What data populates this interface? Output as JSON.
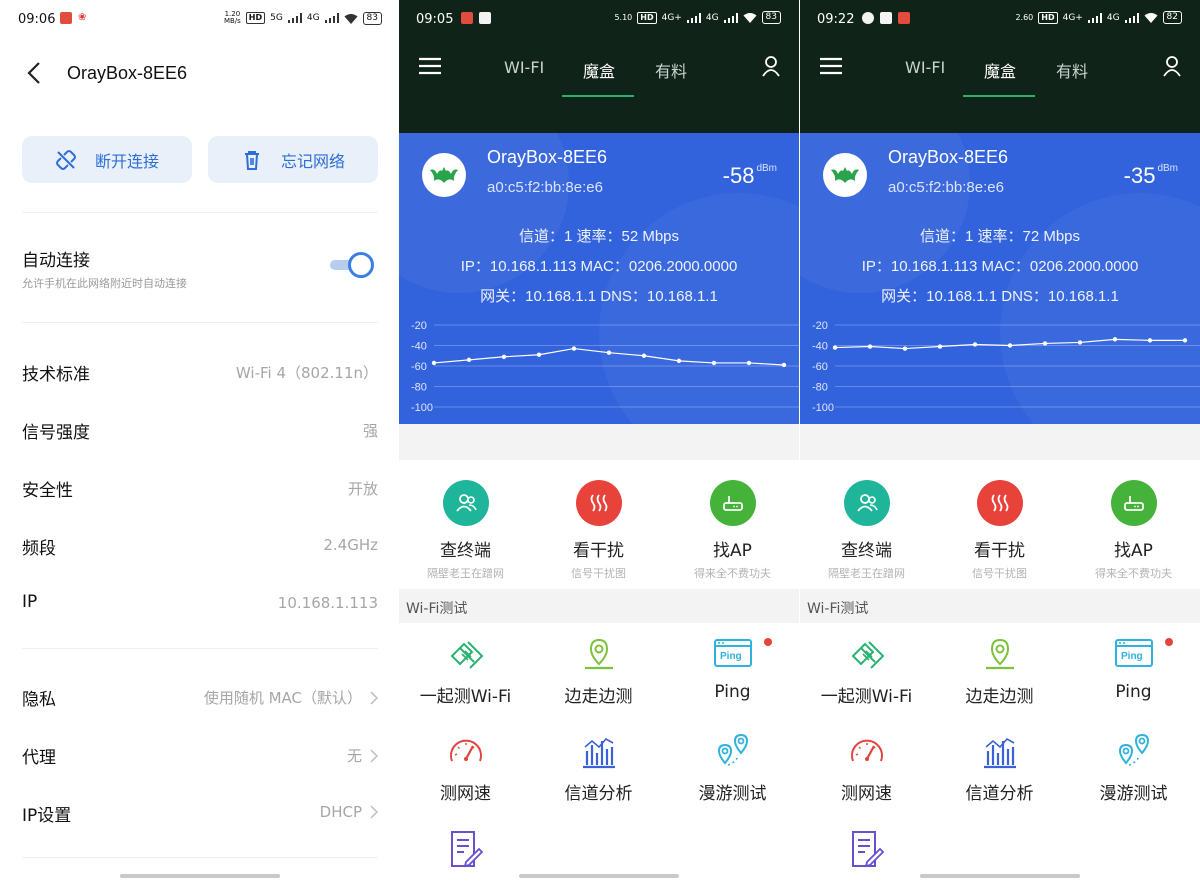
{
  "left": {
    "status": {
      "time": "09:06",
      "speed": "1.20\nMB/s",
      "net1": "5G",
      "net2": "4G",
      "battery": "83"
    },
    "title": "OrayBox-8EE6",
    "disconnect_label": "断开连接",
    "forget_label": "忘记网络",
    "auto_connect": {
      "label": "自动连接",
      "sub": "允许手机在此网络附近时自动连接",
      "on": true
    },
    "rows": [
      {
        "key": "技术标准",
        "value": "Wi-Fi 4（802.11n）",
        "chevron": false
      },
      {
        "key": "信号强度",
        "value": "强",
        "chevron": false
      },
      {
        "key": "安全性",
        "value": "开放",
        "chevron": false
      },
      {
        "key": "频段",
        "value": "2.4GHz",
        "chevron": false
      },
      {
        "key": "IP",
        "value": "10.168.1.113",
        "chevron": false
      },
      {
        "key": "隐私",
        "value": "使用随机 MAC（默认）",
        "chevron": true
      },
      {
        "key": "代理",
        "value": "无",
        "chevron": true
      },
      {
        "key": "IP设置",
        "value": "DHCP",
        "chevron": true
      }
    ]
  },
  "phones": [
    {
      "status": {
        "time": "09:05",
        "speed": "5.10",
        "net": "4G+",
        "net2": "4G",
        "battery": "83"
      },
      "tabs": [
        "WI-FI",
        "魔盒",
        "有料"
      ],
      "active_tab": 1,
      "ssid": "OrayBox-8EE6",
      "mac": "a0:c5:f2:bb:8e:e6",
      "signal": "-58",
      "signal_unit": "dBm",
      "line1": "信道：1  速率：52 Mbps",
      "line2": "IP：10.168.1.113  MAC：0206.2000.0000",
      "line3": "网关：10.168.1.1  DNS：10.168.1.1",
      "chart_data": {
        "type": "line",
        "y_ticks": [
          "-20",
          "-40",
          "-60",
          "-80",
          "-100"
        ],
        "ylim": [
          -100,
          -20
        ],
        "grid": true,
        "series": [
          {
            "values": [
              -57,
              -54,
              -51,
              -49,
              -43,
              -47,
              -50,
              -55,
              -57,
              -57,
              -59
            ]
          }
        ]
      }
    },
    {
      "status": {
        "time": "09:22",
        "speed": "2.60",
        "net": "4G+",
        "net2": "4G",
        "battery": "82"
      },
      "tabs": [
        "WI-FI",
        "魔盒",
        "有料"
      ],
      "active_tab": 1,
      "ssid": "OrayBox-8EE6",
      "mac": "a0:c5:f2:bb:8e:e6",
      "signal": "-35",
      "signal_unit": "dBm",
      "line1": "信道：1  速率：72 Mbps",
      "line2": "IP：10.168.1.113  MAC：0206.2000.0000",
      "line3": "网关：10.168.1.1  DNS：10.168.1.1",
      "chart_data": {
        "type": "line",
        "y_ticks": [
          "-20",
          "-40",
          "-60",
          "-80",
          "-100"
        ],
        "ylim": [
          -100,
          -20
        ],
        "grid": true,
        "series": [
          {
            "values": [
              -42,
              -41,
              -43,
              -41,
              -39,
              -40,
              -38,
              -37,
              -34,
              -35,
              -35
            ]
          }
        ]
      }
    }
  ],
  "tools": [
    {
      "title": "查终端",
      "sub": "隔壁老王在蹭网",
      "color": "#1fb59a",
      "icon": "users-icon"
    },
    {
      "title": "看干扰",
      "sub": "信号干扰图",
      "color": "#e8433a",
      "icon": "heat-icon"
    },
    {
      "title": "找AP",
      "sub": "得来全不费功夫",
      "color": "#45b33a",
      "icon": "router-icon"
    }
  ],
  "section_title": "Wi-Fi测试",
  "tests": [
    {
      "title": "一起测Wi-Fi",
      "icon": "handshake-icon"
    },
    {
      "title": "边走边测",
      "icon": "location-pin-icon"
    },
    {
      "title": "Ping",
      "icon": "ping-icon",
      "ping_text": "Ping"
    },
    {
      "title": "测网速",
      "icon": "speedometer-icon"
    },
    {
      "title": "信道分析",
      "icon": "bar-chart-icon"
    },
    {
      "title": "漫游测试",
      "icon": "roaming-icon"
    }
  ]
}
